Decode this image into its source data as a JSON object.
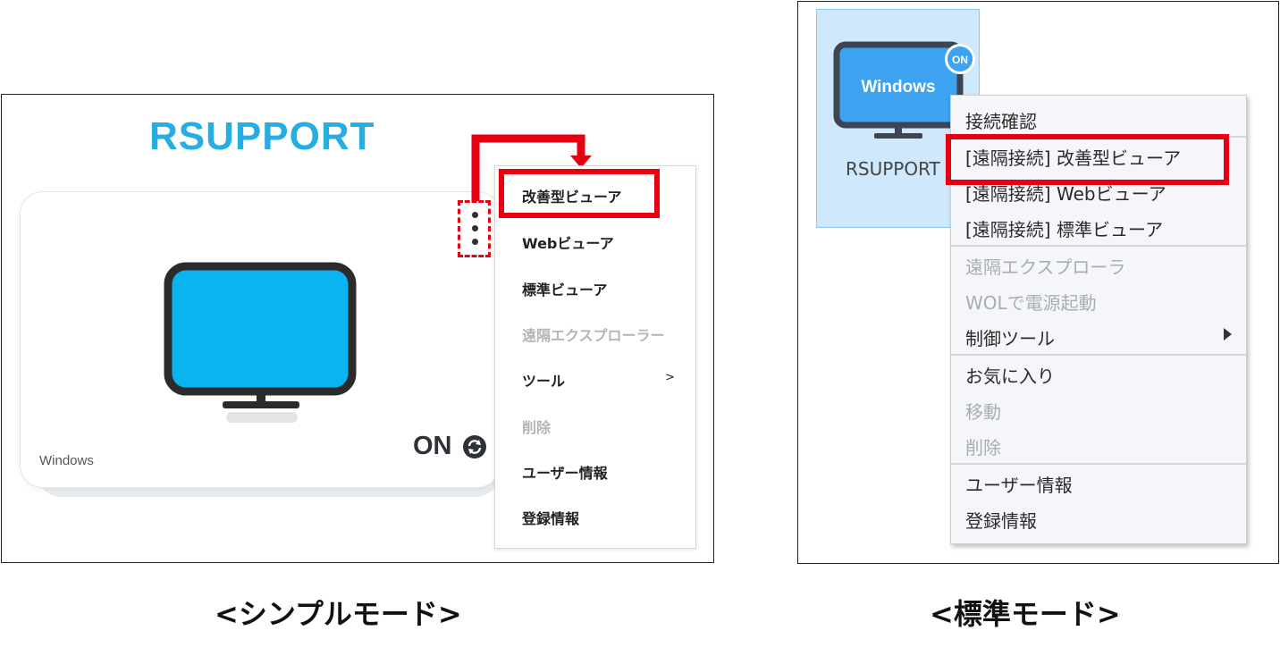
{
  "simple_mode": {
    "brand_title": "RSUPPORT",
    "device": {
      "os_label": "Windows",
      "status": "ON"
    },
    "menu": [
      {
        "label": "改善型ビューア",
        "enabled": true,
        "highlighted": true
      },
      {
        "label": "Webビューア",
        "enabled": true
      },
      {
        "label": "標準ビューア",
        "enabled": true
      },
      {
        "label": "遠隔エクスプローラー",
        "enabled": false
      },
      {
        "label": "ツール",
        "enabled": true,
        "submenu_indicator": ">"
      },
      {
        "label": "削除",
        "enabled": false
      },
      {
        "label": "ユーザー情報",
        "enabled": true
      },
      {
        "label": "登録情報",
        "enabled": true
      }
    ],
    "caption": "<シンプルモード>"
  },
  "standard_mode": {
    "device": {
      "screen_label": "Windows",
      "badge": "ON",
      "name": "RSUPPORT"
    },
    "menu": [
      {
        "label": "接続確認",
        "enabled": true
      },
      {
        "label": "[遠隔接続] 改善型ビューア",
        "enabled": true,
        "highlighted": true
      },
      {
        "label": "[遠隔接続] Webビューア",
        "enabled": true
      },
      {
        "label": "[遠隔接続] 標準ビューア",
        "enabled": true
      },
      {
        "label": "遠隔エクスプローラ",
        "enabled": false
      },
      {
        "label": "WOLで電源起動",
        "enabled": false
      },
      {
        "label": "制御ツール",
        "enabled": true,
        "has_submenu": true
      },
      {
        "label": "お気に入り",
        "enabled": true
      },
      {
        "label": "移動",
        "enabled": false
      },
      {
        "label": "削除",
        "enabled": false
      },
      {
        "label": "ユーザー情報",
        "enabled": true
      },
      {
        "label": "登録情報",
        "enabled": true
      }
    ],
    "caption": "<標準モード>"
  },
  "colors": {
    "highlight_red": "#e60012",
    "brand_blue": "#27aee0",
    "screen_blue_simple": "#0ab4f0",
    "screen_blue_standard": "#3da2f0",
    "tile_selected": "#cfe8fb",
    "disabled_text": "#b4b4b4"
  },
  "icons": {
    "kebab": "more-vertical-icon",
    "refresh": "refresh-icon",
    "monitor": "monitor-icon",
    "submenu": "triangle-right-icon",
    "arrow": "red-arrow-icon"
  }
}
